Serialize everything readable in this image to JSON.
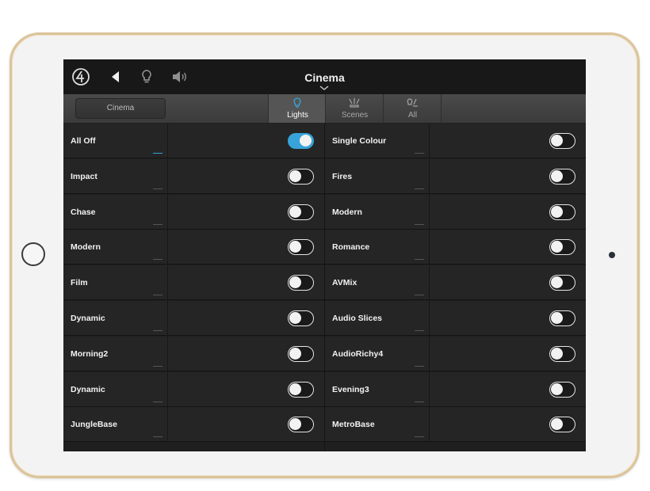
{
  "header": {
    "title": "Cinema",
    "icons": [
      "control4-logo-icon",
      "back-arrow-icon",
      "lightbulb-icon",
      "speaker-icon",
      "chevron-down-icon"
    ]
  },
  "subbar": {
    "room_button": "Cinema",
    "tabs": [
      {
        "label": "Lights",
        "icon": "lightbulb-icon",
        "active": true
      },
      {
        "label": "Scenes",
        "icon": "scenes-icon",
        "active": false
      },
      {
        "label": "All",
        "icon": "all-icon",
        "active": false
      }
    ]
  },
  "colors": {
    "accent": "#37a3d9",
    "background": "#1f1f1f",
    "device_bezel": "#dbc49a"
  },
  "left_column": [
    {
      "label": "All Off",
      "on": true
    },
    {
      "label": "Impact",
      "on": false
    },
    {
      "label": "Chase",
      "on": false
    },
    {
      "label": "Modern",
      "on": false
    },
    {
      "label": "Film",
      "on": false
    },
    {
      "label": "Dynamic",
      "on": false
    },
    {
      "label": "Morning2",
      "on": false
    },
    {
      "label": "Dynamic",
      "on": false
    },
    {
      "label": "JungleBase",
      "on": false
    }
  ],
  "right_column": [
    {
      "label": "Single Colour",
      "on": false
    },
    {
      "label": "Fires",
      "on": false
    },
    {
      "label": "Modern",
      "on": false
    },
    {
      "label": "Romance",
      "on": false
    },
    {
      "label": "AVMix",
      "on": false
    },
    {
      "label": "Audio Slices",
      "on": false
    },
    {
      "label": "AudioRichy4",
      "on": false
    },
    {
      "label": "Evening3",
      "on": false
    },
    {
      "label": "MetroBase",
      "on": false
    }
  ]
}
